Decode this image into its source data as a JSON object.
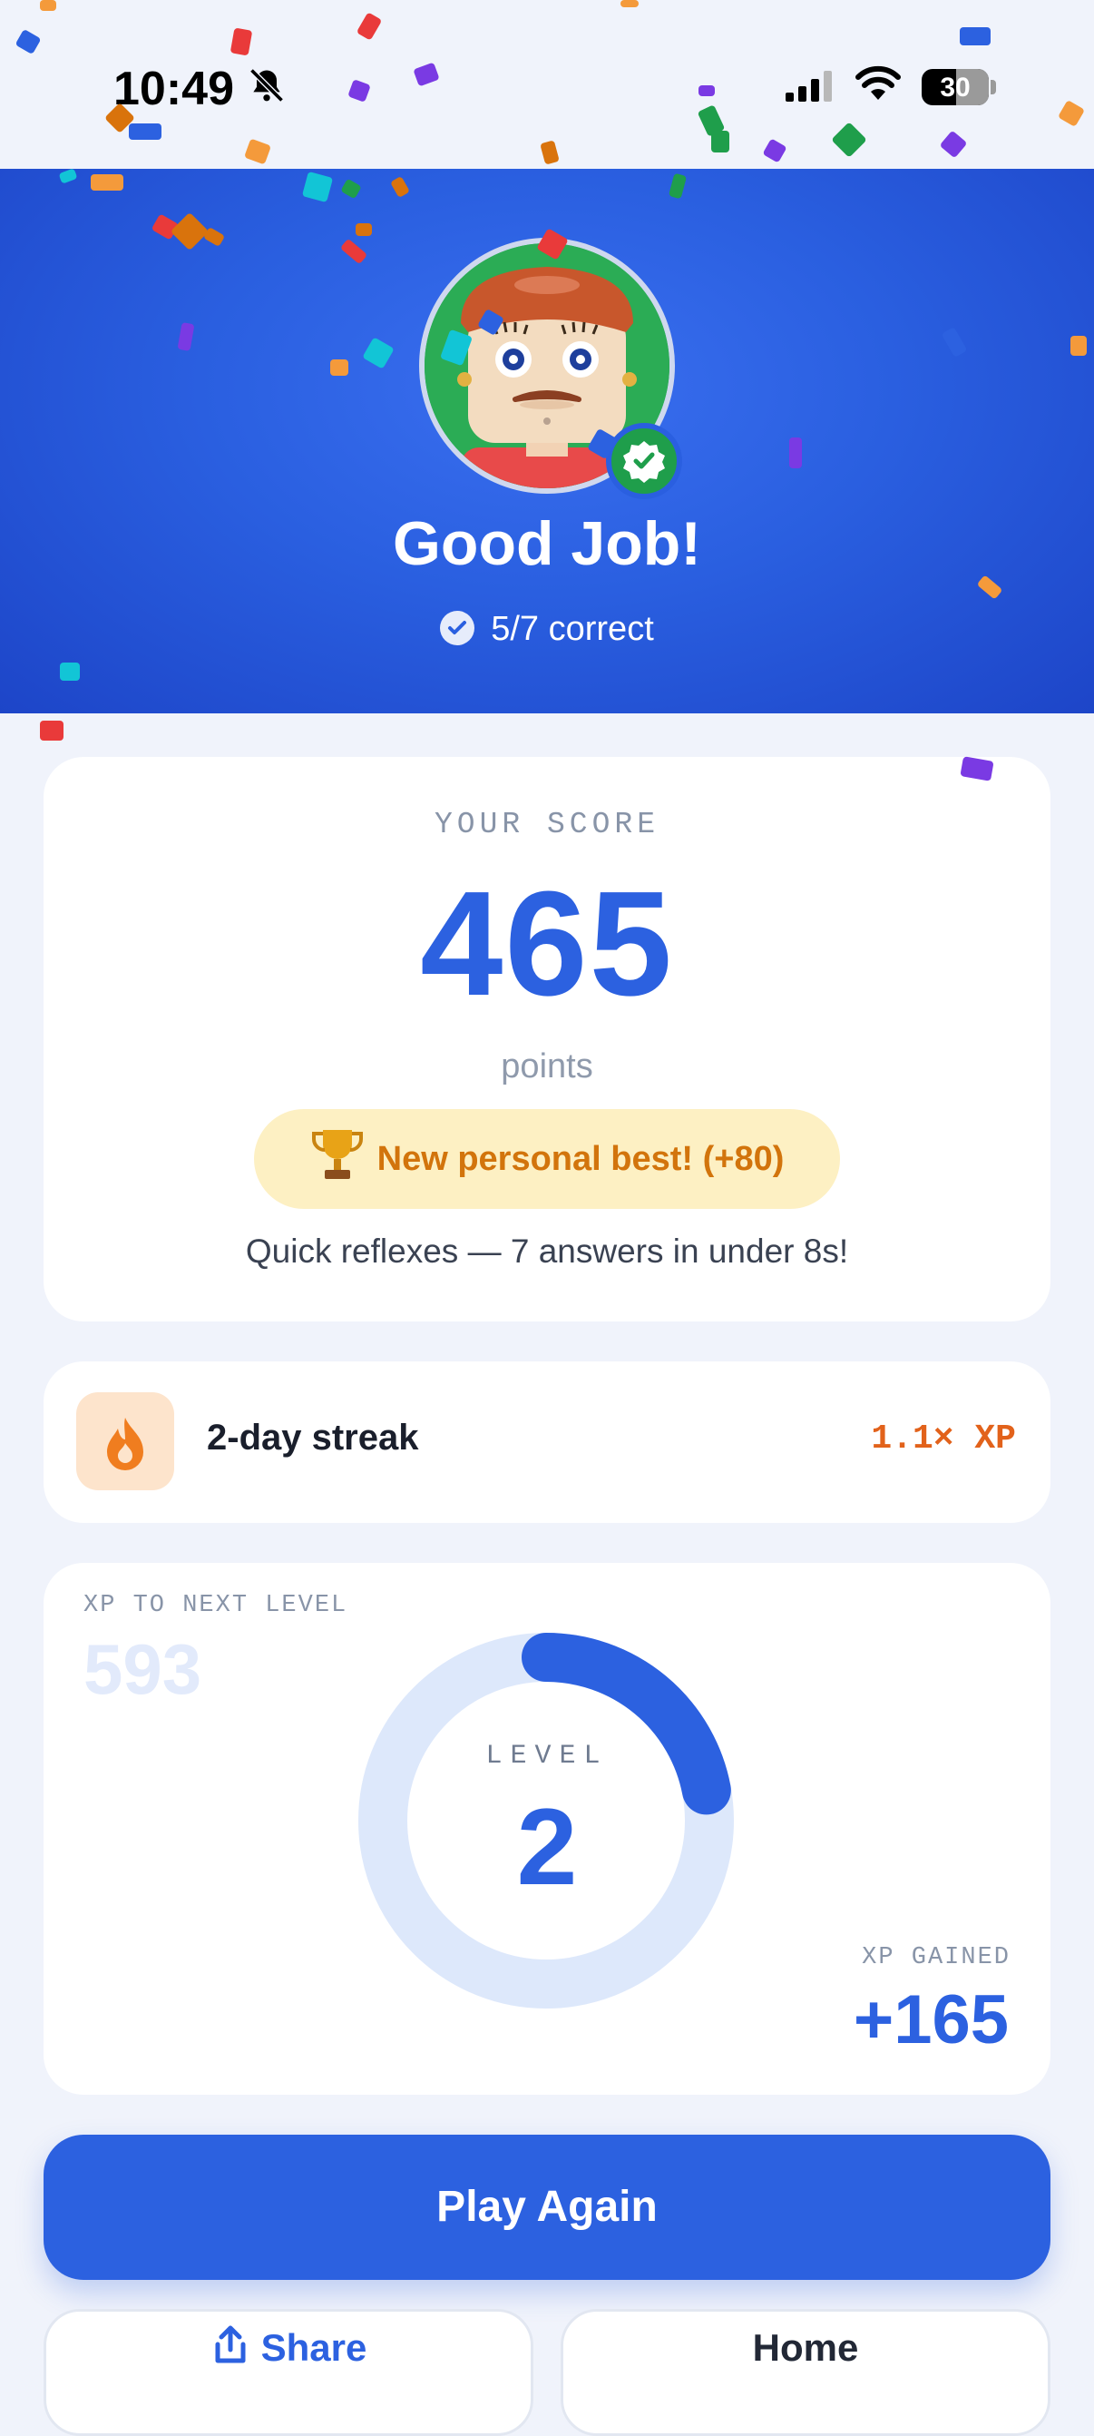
{
  "status_bar": {
    "time": "10:49",
    "battery": "30",
    "icons": [
      "bell-slash-icon",
      "signal-icon",
      "wifi-icon",
      "battery-icon"
    ]
  },
  "hero": {
    "title": "Good Job!",
    "result": "5/7 correct",
    "avatar_icon": "avatar-portrait",
    "badge_icon": "verified-check-icon"
  },
  "score": {
    "label": "YOUR SCORE",
    "value": "465",
    "unit": "points",
    "best_label": "New personal best! (+80)",
    "best_icon": "trophy-icon",
    "note": "Quick reflexes — 7 answers in under 8s!"
  },
  "streak": {
    "label": "2-day streak",
    "multiplier": "1.1× XP",
    "icon": "flame-icon"
  },
  "level": {
    "xp_next_label": "XP TO NEXT LEVEL",
    "xp_next_value": "593",
    "level_label": "LEVEL",
    "level_value": "2",
    "progress_fraction": 0.22,
    "xp_gained_label": "XP GAINED",
    "xp_gained_value": "+165"
  },
  "actions": {
    "play_again": "Play Again",
    "share": "Share",
    "home": "Home"
  },
  "colors": {
    "accent": "#2c61e0",
    "hero_bg": "#2a5fe0",
    "success": "#1f9e4b",
    "streak": "#e2621b",
    "best": "#d2740c"
  }
}
